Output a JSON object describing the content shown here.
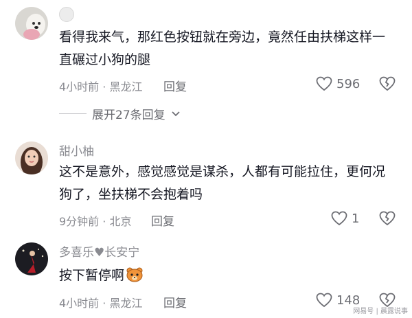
{
  "comments": [
    {
      "username": "",
      "text": "看得我来气，那红色按钮就在旁边，竟然任由扶梯这样一直碾过小狗的腿",
      "time": "4小时前",
      "location": "黑龙江",
      "reply_label": "回复",
      "likes": "596",
      "expand_label": "展开27条回复"
    },
    {
      "username": "甜小柚",
      "text": "这不是意外，感觉感觉是谋杀，人都有可能拉住，更何况狗了，坐扶梯不会抱着吗",
      "time": "9分钟前",
      "location": "北京",
      "reply_label": "回复",
      "likes": "1"
    },
    {
      "username": "多喜乐♥长安宁",
      "text": "按下暂停啊",
      "time": "4小时前",
      "location": "黑龙江",
      "reply_label": "回复",
      "likes": "148"
    }
  ],
  "meta_separator": " · ",
  "watermark": "网易号 | 晨露说事",
  "colors": {
    "text": "#161823",
    "meta": "#8a8b91",
    "accent_bear": "#f0943a"
  }
}
